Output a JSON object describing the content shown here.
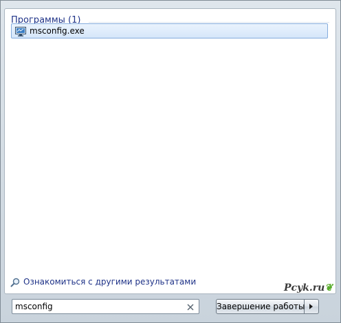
{
  "results": {
    "section_title": "Программы (1)",
    "items": [
      {
        "label": "msconfig.exe",
        "icon": "system-configuration-icon"
      }
    ]
  },
  "more_results": {
    "label": "Ознакомиться с другими результатами",
    "icon": "search-magnifier-icon"
  },
  "search": {
    "value": "msconfig",
    "clear_icon": "clear-x-icon"
  },
  "shutdown": {
    "label": "Завершение работы",
    "arrow_icon": "chevron-right-icon"
  },
  "watermark": {
    "text": "Pcyk.ru"
  },
  "colors": {
    "section_title": "#1e3287",
    "selection_border": "#84acdd",
    "selection_fill": "#d5e6fa",
    "watermark_leaf": "#5cae2f"
  }
}
